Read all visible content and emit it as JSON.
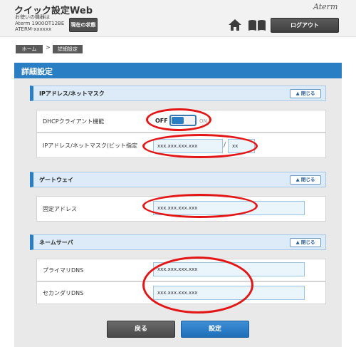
{
  "header": {
    "app_title": "クイック設定Web",
    "device_caption": "お使いの機器は",
    "device_model": "Aterm 1900OT12BE",
    "device_name": "ATERM-xxxxxx",
    "status_button": "現在の状態",
    "brand": "Aterm",
    "logout_button": "ログアウト",
    "icons": [
      "home-icon",
      "book-icon"
    ]
  },
  "breadcrumb": {
    "home": "ホーム",
    "separator": ">",
    "current": "詳細設定"
  },
  "page_title": "詳細設定",
  "sections": {
    "ip": {
      "title": "IPアドレス/ネットマスク",
      "close_label": "閉じる",
      "dhcp_label": "DHCPクライアント機能",
      "toggle_off": "OFF",
      "toggle_on": "ON",
      "ip_label": "IPアドレス/ネットマスク(ビット指定",
      "ip_value": "xxx.xxx.xxx.xxx",
      "slash": "/",
      "mask_value": "xx"
    },
    "gateway": {
      "title": "ゲートウェイ",
      "close_label": "閉じる",
      "fixed_label": "固定アドレス",
      "fixed_value": "xxx.xxx.xxx.xxx"
    },
    "dns": {
      "title": "ネームサーバ",
      "close_label": "閉じる",
      "primary_label": "プライマリDNS",
      "primary_value": "xxx.xxx.xxx.xxx",
      "secondary_label": "セカンダリDNS",
      "secondary_value": "xxx.xxx.xxx.xxx"
    }
  },
  "buttons": {
    "back": "戻る",
    "submit": "設定"
  },
  "colors": {
    "accent": "#2a7fc4",
    "annotation": "#e41515",
    "header_bg": "#f2f2f2",
    "panel_bg": "#e9e9e9"
  }
}
